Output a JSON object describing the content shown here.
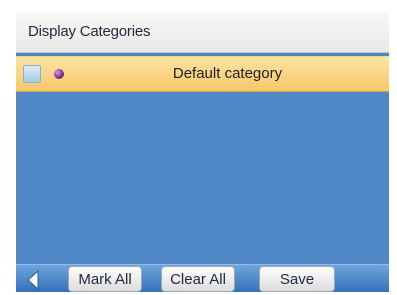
{
  "header": {
    "title": "Display Categories"
  },
  "categories": [
    {
      "label": "Default category",
      "checked": false,
      "dot_color": "#8b2aa6",
      "selected": true
    }
  ],
  "toolbar": {
    "back_icon": "chevron-left-icon",
    "mark_all_label": "Mark All",
    "clear_all_label": "Clear All",
    "save_label": "Save"
  },
  "colors": {
    "background": "#4f86c6",
    "selected_row": "#f7c76a",
    "toolbar": "#2f6fb6"
  }
}
